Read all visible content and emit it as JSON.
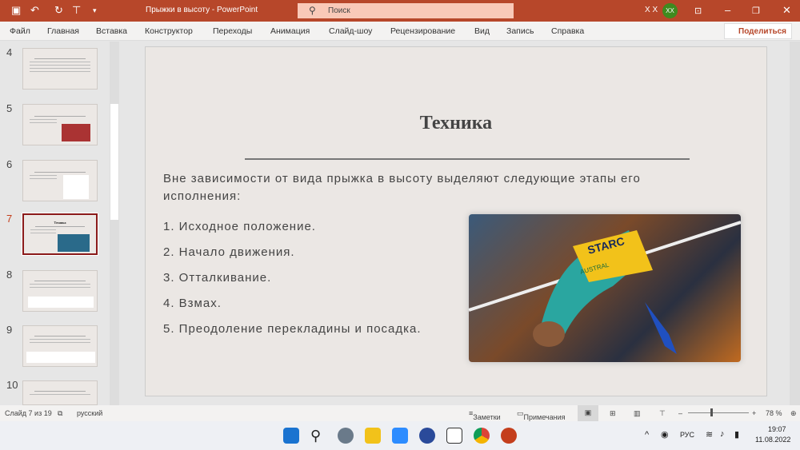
{
  "titlebar": {
    "doc_title": "Прыжки в высоту  -  PowerPoint",
    "search_placeholder": "Поиск",
    "user_name": "X X",
    "avatar_initials": "XX"
  },
  "menu": [
    "Файл",
    "Главная",
    "Вставка",
    "Конструктор",
    "Переходы",
    "Анимация",
    "Слайд-шоу",
    "Рецензирование",
    "Вид",
    "Запись",
    "Справка"
  ],
  "share_label": "Поделиться",
  "thumbnails": [
    {
      "num": "4"
    },
    {
      "num": "5"
    },
    {
      "num": "6"
    },
    {
      "num": "7",
      "title": "Техника"
    },
    {
      "num": "8"
    },
    {
      "num": "9"
    },
    {
      "num": "10"
    }
  ],
  "slide": {
    "title": "Техника",
    "intro": "Вне зависимости от вида прыжка в высоту выделяют следующие этапы его исполнения:",
    "items": [
      "1. Исходное положение.",
      "2. Начало движения.",
      "3. Отталкивание.",
      "4. Взмах.",
      "5. Преодоление перекладины и посадка."
    ],
    "photo_bib": "STARC",
    "photo_bib2": "AUSTRAL"
  },
  "status": {
    "slide_counter": "Слайд 7 из 19",
    "language": "русский",
    "notes": "Заметки",
    "comments": "Примечания",
    "zoom": "78 %"
  },
  "taskbar": {
    "lang": "РУС",
    "time": "19:07",
    "date": "11.08.2022"
  }
}
